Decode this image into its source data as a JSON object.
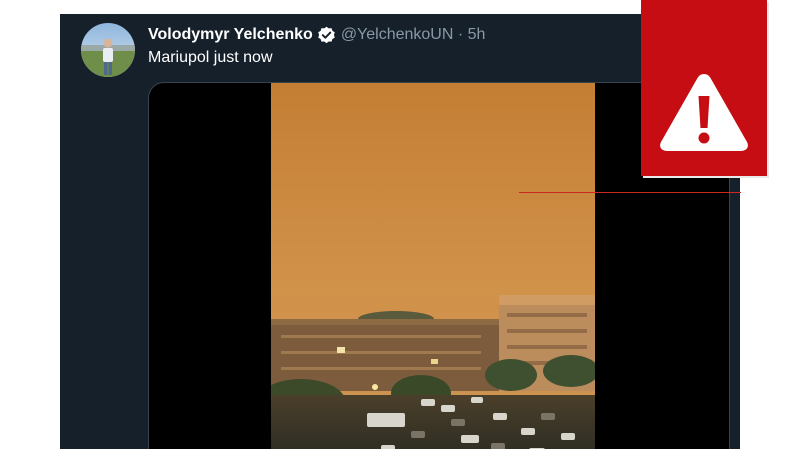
{
  "tweet": {
    "display_name": "Volodymyr Yelchenko",
    "verified": true,
    "handle_meta": "@YelchenkoUN · 5h",
    "text": "Mariupol just now",
    "avatar_icon": "person-avatar",
    "verified_icon": "verified-badge-icon"
  },
  "media": {
    "type": "video",
    "sky_color": "#c98a3c",
    "ground_color": "#3a3526"
  },
  "overlay": {
    "icon": "warning-triangle-icon",
    "background": "#c50d13"
  },
  "colors": {
    "card_background": "#15202b",
    "name": "#ffffff",
    "handle": "#8899a6",
    "media_border": "#38444d"
  }
}
